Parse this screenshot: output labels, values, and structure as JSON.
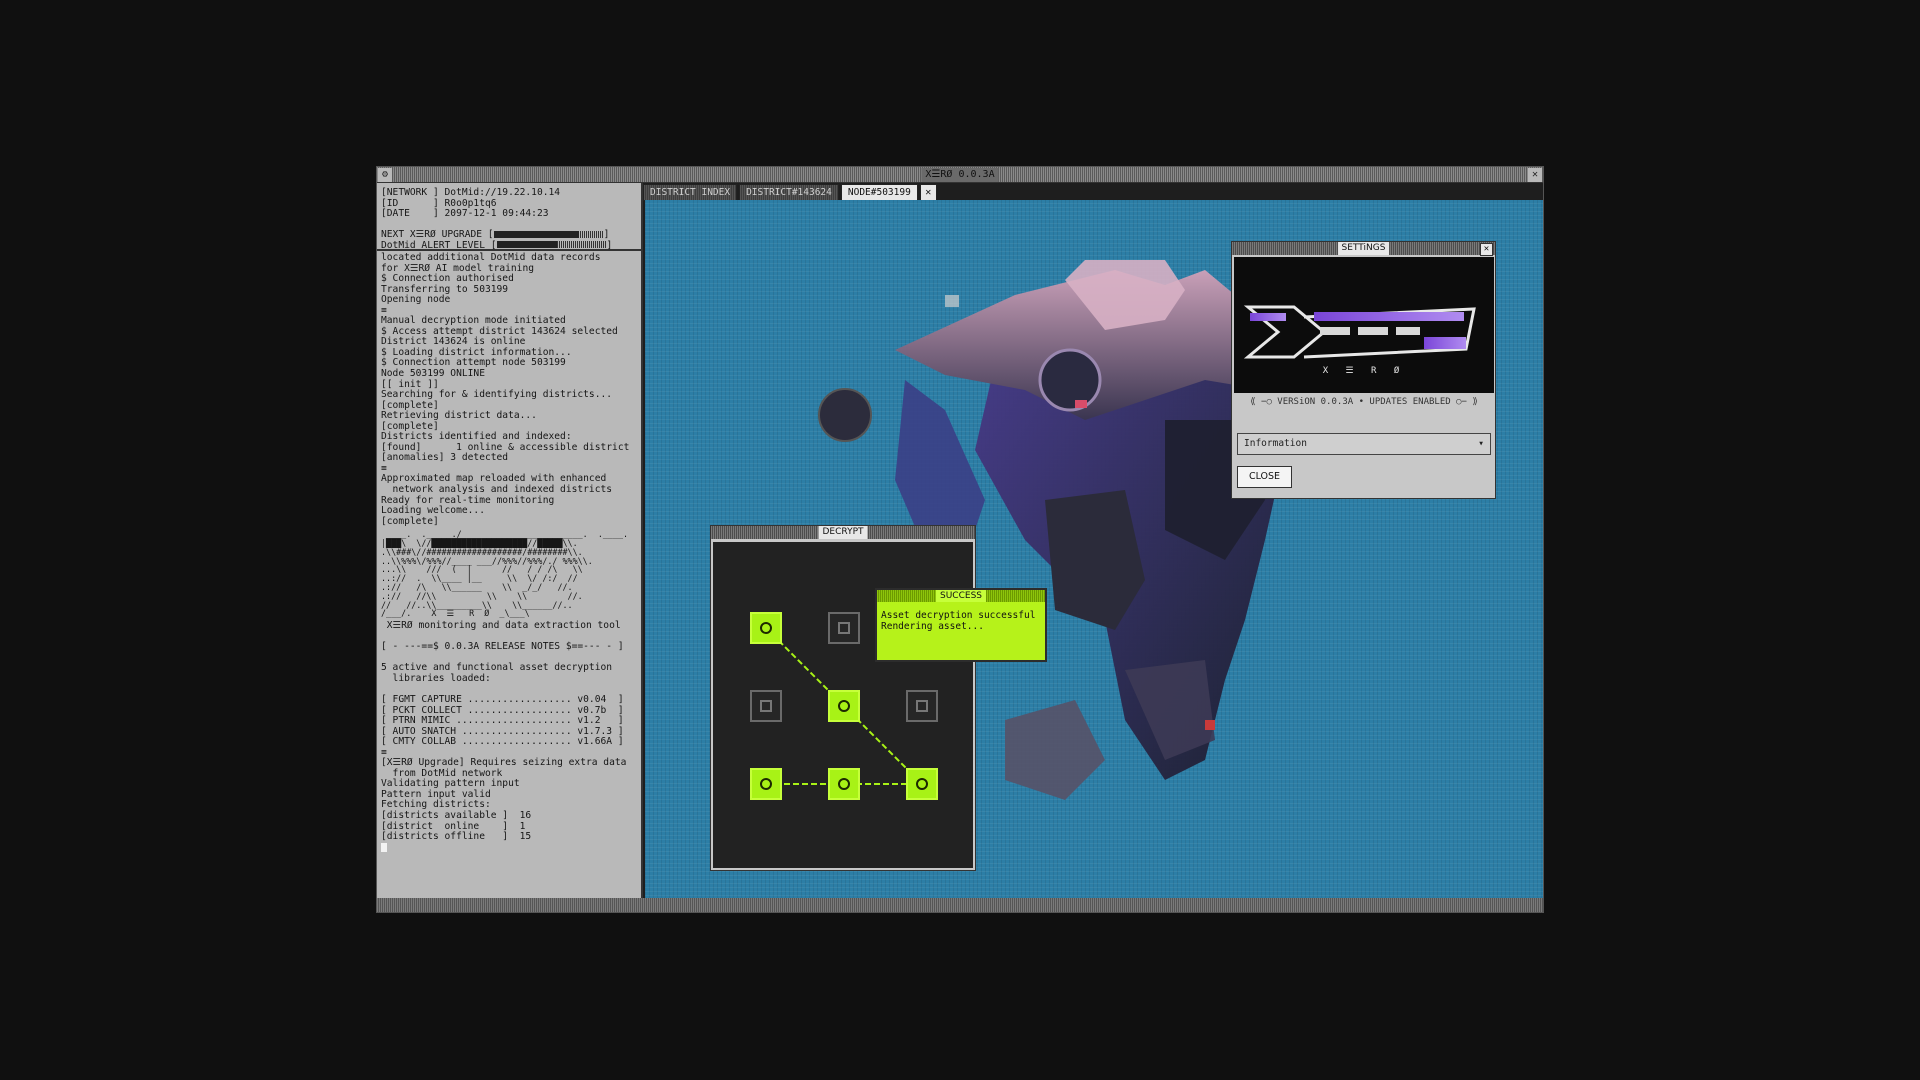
{
  "window": {
    "title": "X☰RØ 0.0.3A"
  },
  "terminal": {
    "header": [
      "[NETWORK ] DotMid://19.22.10.14",
      "[ID      ] R0o0p1tq6",
      "[DATE    ] 2097-12-1 09:44:23"
    ],
    "upgrade_label": "NEXT X☰RØ UPGRADE",
    "upgrade_progress": 0.78,
    "alert_label": "DotMid ALERT LEVEL",
    "alert_progress": 0.55,
    "log": [
      "located additional DotMid data records",
      "for X☰RØ AI model training",
      "$ Connection authorised",
      "Transferring to 503199",
      "Opening node",
      "≡",
      "Manual decryption mode initiated",
      "$ Access attempt district 143624 selected",
      "District 143624 is online",
      "$ Loading district information...",
      "$ Connection attempt node 503199",
      "Node 503199 ONLINE",
      "[[ init ]]",
      "Searching for & identifying districts...",
      "[complete]",
      "Retrieving district data...",
      "[complete]",
      "Districts identified and indexed:",
      "[found]      1 online & accessible district",
      "[anomalies] 3 detected",
      "≡",
      "Approximated map reloaded with enhanced",
      "  network analysis and indexed districts",
      "Ready for real-time monitoring",
      "Loading welcome...",
      "[complete]"
    ],
    "ascii_art": [
      " ____.  .___  ./________________________.  .____.",
      "|███\\  \\//███████████████████//█████\\\\.",
      ".\\\\###\\//###################/########\\\\.",
      "..\\\\%%%\\/%%%//____ ___//%%%//%%%/./ %%%\\\\.",
      "...\\\\    ///  (  |      //   / / /\\   \\\\",
      "..://  .  \\\\____ |__     \\\\  \\/ /:/  //",
      ".://   /\\   \\\\______    \\\\  _/_/   //.",
      ".://   //\\\\          \\\\    \\\\        //.",
      "//   //..\\\\_________\\\\    \\\\______//..",
      "/___/.    X  ☰   R  Ø  _\\___\\"
    ],
    "tagline": " X☰RØ monitoring and data extraction tool",
    "release_notes": "[ - ---==$ 0.0.3A RELEASE NOTES $==--- - ]",
    "libs_intro": [
      "5 active and functional asset decryption",
      "  libraries loaded:"
    ],
    "libraries": [
      "[ FGMT CAPTURE .................. v0.04  ]",
      "[ PCKT COLLECT .................. v0.7b  ]",
      "[ PTRN MIMIC .................... v1.2   ]",
      "[ AUTO SNATCH ................... v1.7.3 ]",
      "[ CMTY COLLAB ................... v1.66A ]"
    ],
    "tail": [
      "≡",
      "[X☰RØ Upgrade] Requires seizing extra data",
      "  from DotMid network",
      "Validating pattern input",
      "Pattern input valid",
      "Fetching districts:",
      "[districts available ]  16",
      "[district  online    ]  1",
      "[districts offline   ]  15"
    ]
  },
  "tabs": [
    {
      "label": "DISTRICT INDEX",
      "active": false
    },
    {
      "label": "DISTRICT#143624",
      "active": false
    },
    {
      "label": "NODE#503199",
      "active": true
    }
  ],
  "decrypt": {
    "title": "DECRYPT",
    "grid": [
      true,
      false,
      false,
      false,
      true,
      false,
      true,
      true,
      true
    ]
  },
  "success": {
    "title": "SUCCESS",
    "lines": [
      "Asset decryption successful",
      "Rendering asset..."
    ]
  },
  "settings": {
    "title": "SETTiNGS",
    "logo_text": "X ☰ R Ø",
    "version": "⟪ −○ VERSiON 0.0.3A • UPDATES ENABLED ○− ⟫",
    "dropdown": "Information",
    "close_label": "CLOSE"
  },
  "colors": {
    "accent": "#a8f216",
    "viewport": "#2c7ea6",
    "logo_purple": "#8a55e0"
  }
}
